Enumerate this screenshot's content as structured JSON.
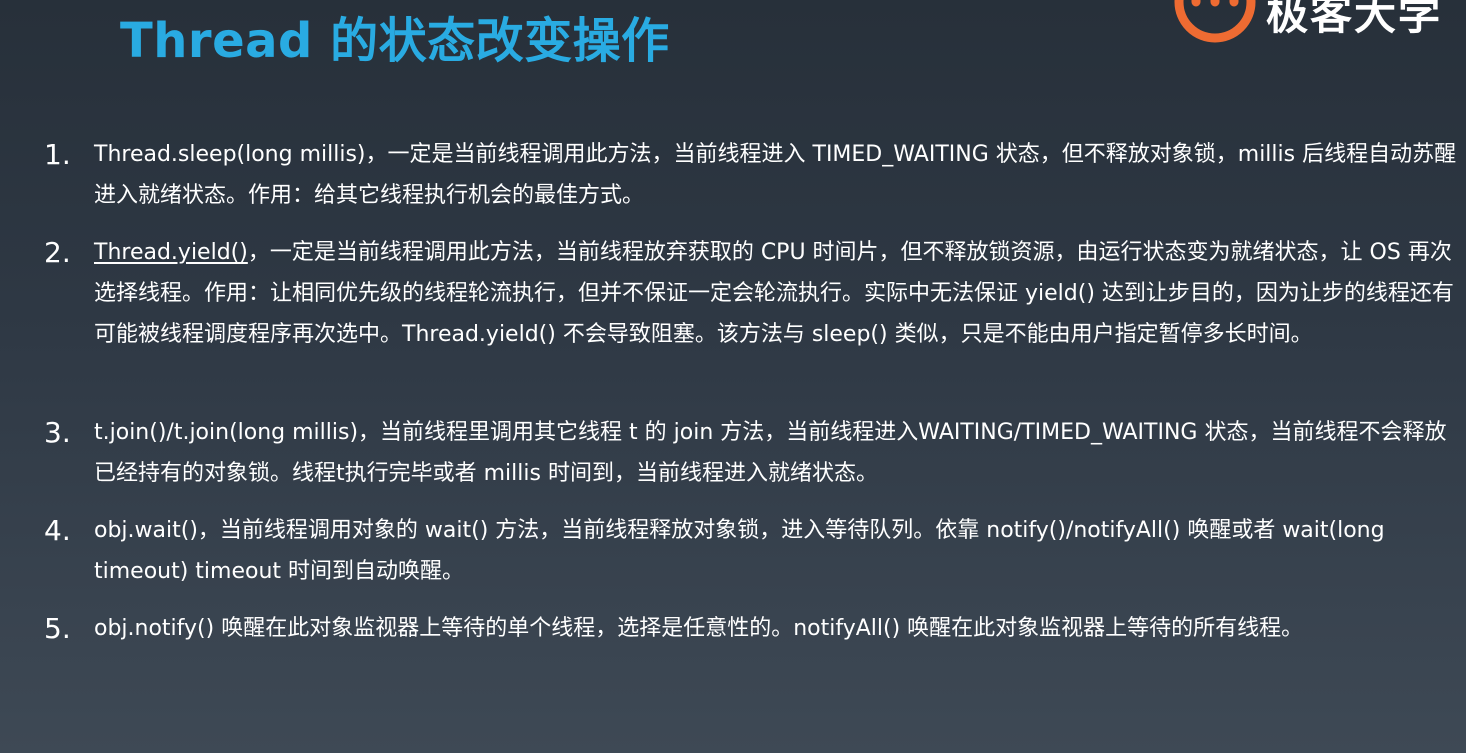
{
  "slide": {
    "title": "Thread 的状态改变操作",
    "title_color": "#29abe2",
    "logo_text": "极客大学",
    "logo_color": "#ee6b32",
    "logo_icon": "geek-logo-icon"
  },
  "points": [
    {
      "number": "1.",
      "text": "Thread.sleep(long millis)，一定是当前线程调用此方法，当前线程进入 TIMED_WAITING 状态，但不释放对象锁，millis 后线程自动苏醒进入就绪状态。作用：给其它线程执行机会的最佳方式。"
    },
    {
      "number": "2.",
      "link": "Thread.yield()",
      "text": "，一定是当前线程调用此方法，当前线程放弃获取的 CPU 时间片，但不释放锁资源，由运行状态变为就绪状态，让 OS 再次选择线程。作用：让相同优先级的线程轮流执行，但并不保证一定会轮流执行。实际中无法保证 yield() 达到让步目的，因为让步的线程还有可能被线程调度程序再次选中。Thread.yield() 不会导致阻塞。该方法与 sleep() 类似，只是不能由用户指定暂停多长时间。"
    },
    {
      "number": "3.",
      "text": "t.join()/t.join(long millis)，当前线程里调用其它线程 t 的 join 方法，当前线程进入WAITING/TIMED_WAITING 状态，当前线程不会释放已经持有的对象锁。线程t执行完毕或者 millis 时间到，当前线程进入就绪状态。"
    },
    {
      "number": "4.",
      "text": "obj.wait()，当前线程调用对象的 wait() 方法，当前线程释放对象锁，进入等待队列。依靠 notify()/notifyAll() 唤醒或者 wait(long timeout) timeout 时间到自动唤醒。"
    },
    {
      "number": "5.",
      "text": "obj.notify() 唤醒在此对象监视器上等待的单个线程，选择是任意性的。notifyAll() 唤醒在此对象监视器上等待的所有线程。"
    }
  ]
}
